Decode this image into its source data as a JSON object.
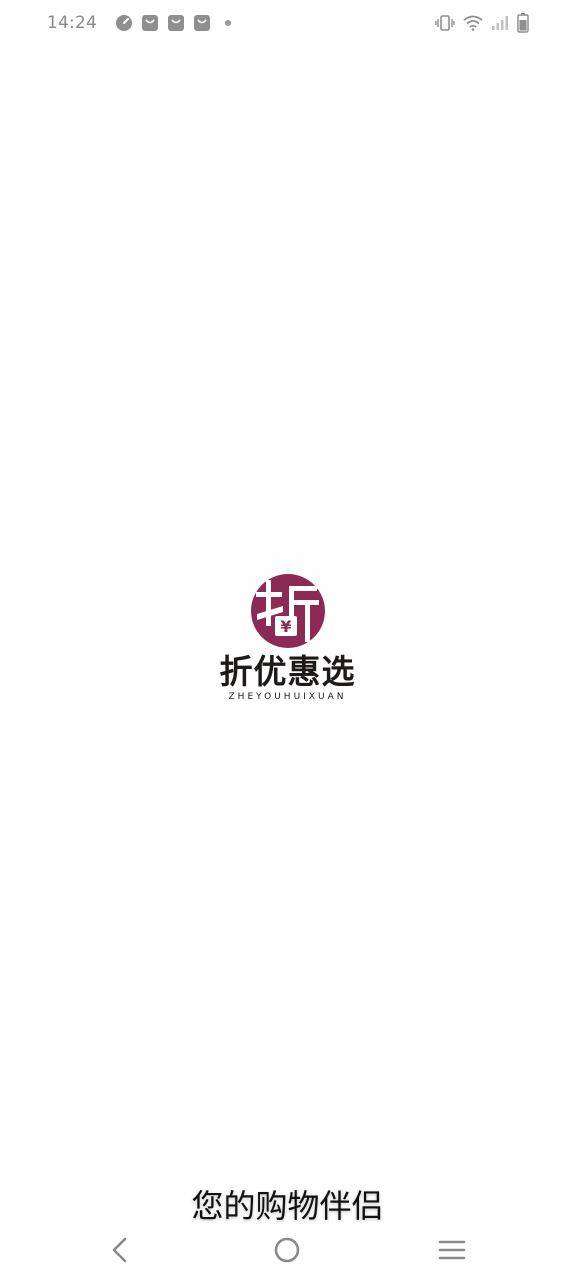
{
  "status_bar": {
    "time": "14:24",
    "notification_icons": [
      "speedometer-icon",
      "shopping-bag-icon",
      "shopping-bag-icon",
      "shopping-bag-icon",
      "dot-icon"
    ],
    "system_icons": [
      "vibrate-icon",
      "wifi-icon",
      "cell-signal-icon",
      "battery-icon"
    ]
  },
  "logo": {
    "mark_glyph": "折",
    "yen_glyph": "¥",
    "brand_name": "折优惠选",
    "brand_pinyin": "ZHEYOUHUIXUAN",
    "brand_color": "#8c2a55"
  },
  "slogan": "您的购物伴侣",
  "nav_bar": {
    "buttons": [
      "back",
      "home",
      "menu"
    ]
  }
}
